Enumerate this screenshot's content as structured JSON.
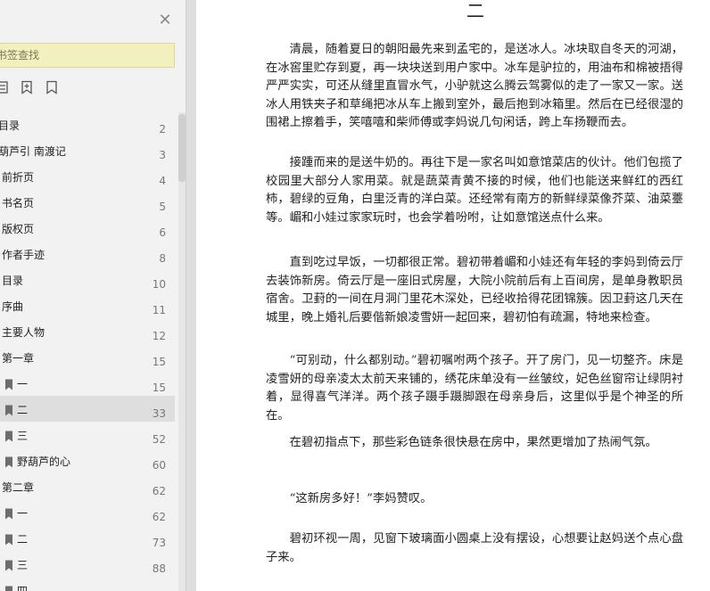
{
  "sidebar": {
    "search_placeholder": "书签查找",
    "toc": [
      {
        "label": "目录",
        "page": "2",
        "bookmark": false
      },
      {
        "label": "葫芦引 南渡记",
        "page": "3",
        "bookmark": false
      },
      {
        "label": "前折页",
        "page": "4",
        "bookmark": false
      },
      {
        "label": "书名页",
        "page": "5",
        "bookmark": false
      },
      {
        "label": "版权页",
        "page": "6",
        "bookmark": false
      },
      {
        "label": "作者手迹",
        "page": "8",
        "bookmark": false
      },
      {
        "label": "目录",
        "page": "10",
        "bookmark": false
      },
      {
        "label": "序曲",
        "page": "11",
        "bookmark": false
      },
      {
        "label": "主要人物",
        "page": "12",
        "bookmark": false
      },
      {
        "label": "第一章",
        "page": "15",
        "bookmark": false
      },
      {
        "label": "一",
        "page": "15",
        "bookmark": true
      },
      {
        "label": "二",
        "page": "33",
        "bookmark": true,
        "selected": true
      },
      {
        "label": "三",
        "page": "52",
        "bookmark": true
      },
      {
        "label": "野葫芦的心",
        "page": "60",
        "bookmark": true
      },
      {
        "label": "第二章",
        "page": "62",
        "bookmark": false
      },
      {
        "label": "一",
        "page": "62",
        "bookmark": true
      },
      {
        "label": "二",
        "page": "73",
        "bookmark": true
      },
      {
        "label": "三",
        "page": "88",
        "bookmark": true
      },
      {
        "label": "四",
        "page": "",
        "bookmark": true
      }
    ]
  },
  "reader": {
    "heading": "二",
    "paragraphs": [
      "清晨，随着夏日的朝阳最先来到孟宅的，是送冰人。冰块取自冬天的河湖，在冰窖里贮存到夏，再一块块送到用户家中。冰车是驴拉的，用油布和棉被捂得严严实实，可还从缝里直冒水气，小驴就这么腾云驾雾似的走了一家又一家。送冰人用铁夹子和草绳把冰从车上搬到室外，最后抱到冰箱里。然后在已经很湿的围裙上擦着手，笑嘻嘻和柴师傅或李妈说几句闲话，跨上车扬鞭而去。",
      "接踵而来的是送牛奶的。再往下是一家名叫如意馆菜店的伙计。他们包揽了校园里大部分人家用菜。就是蔬菜青黄不接的时候，他们也能送来鲜红的西红柿，碧绿的豆角，白里泛青的洋白菜。还经常有南方的新鲜绿菜像芥菜、油菜薹等。嵋和小娃过家家玩时，也会学着吩咐，让如意馆送点什么来。",
      "直到吃过早饭，一切都很正常。碧初带着嵋和小娃还有年轻的李妈到倚云厅去装饰新房。倚云厅是一座旧式房屋，大院小院前后有上百间房，是单身教职员宿舍。卫葑的一间在月洞门里花木深处，已经收拾得花团锦簇。因卫葑这几天在城里，晚上婚礼后要偕新娘凌雪妍一起回来，碧初怕有疏漏，特地来检查。",
      "“可别动，什么都别动。”碧初嘱咐两个孩子。开了房门，见一切整齐。床是凌雪妍的母亲凌太太前天来铺的，绣花床单没有一丝皱纹，妃色丝窗帘让绿阴衬着，显得喜气洋洋。两个孩子蹑手蹑脚跟在母亲身后，这里似乎是个神圣的所在。",
      "在碧初指点下，那些彩色链条很快悬在房中，果然更增加了热闹气氛。",
      "“这新房多好！”李妈赞叹。",
      "碧初环视一周，见窗下玻璃面小圆桌上没有摆设，心想要让赵妈送个点心盘子来。"
    ]
  }
}
